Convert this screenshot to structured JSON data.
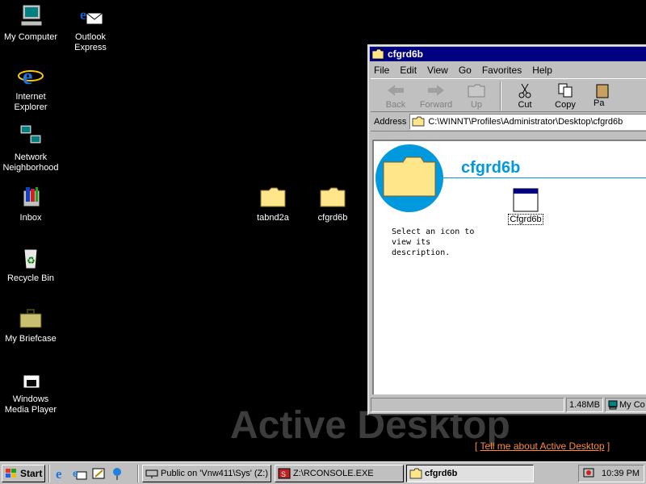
{
  "desktop": {
    "icons": [
      {
        "label": "My Computer",
        "icon": "my-computer-icon"
      },
      {
        "label": "Outlook Express",
        "icon": "outlook-express-icon"
      },
      {
        "label": "Internet Explorer",
        "icon": "internet-explorer-icon"
      },
      {
        "label": "Network Neighborhood",
        "icon": "network-neighborhood-icon"
      },
      {
        "label": "Inbox",
        "icon": "inbox-icon"
      },
      {
        "label": "Recycle Bin",
        "icon": "recycle-bin-icon"
      },
      {
        "label": "My Briefcase",
        "icon": "briefcase-icon"
      },
      {
        "label": "Windows Media Player",
        "icon": "media-player-icon"
      },
      {
        "label": "tabnd2a",
        "icon": "folder-icon"
      },
      {
        "label": "cfgrd6b",
        "icon": "folder-icon"
      }
    ],
    "watermark": "Active Desktop",
    "link_open": "[",
    "link_text": "Tell me about Active Desktop",
    "link_close": "]"
  },
  "window": {
    "title": "cfgrd6b",
    "menu": [
      "File",
      "Edit",
      "View",
      "Go",
      "Favorites",
      "Help"
    ],
    "toolbar": {
      "back": "Back",
      "forward": "Forward",
      "up": "Up",
      "cut": "Cut",
      "copy": "Copy",
      "paste": "Pa"
    },
    "address_label": "Address",
    "address_value": "C:\\WINNT\\Profiles\\Administrator\\Desktop\\cfgrd6b",
    "folder_heading": "cfgrd6b",
    "description": "Select an icon to view its description.",
    "file_label": "Cfgrd6b",
    "status_size": "1.48MB",
    "status_location": "My Co"
  },
  "taskbar": {
    "start": "Start",
    "tasks": [
      {
        "label": "Public on 'Vnw411\\Sys' (Z:)"
      },
      {
        "label": "Z:\\RCONSOLE.EXE"
      },
      {
        "label": "cfgrd6b"
      }
    ],
    "clock": "10:39 PM"
  },
  "colors": {
    "desktop": "#000000",
    "title_bar": "#000080",
    "accent": "#0099dd",
    "link": "#ff8a3a"
  }
}
